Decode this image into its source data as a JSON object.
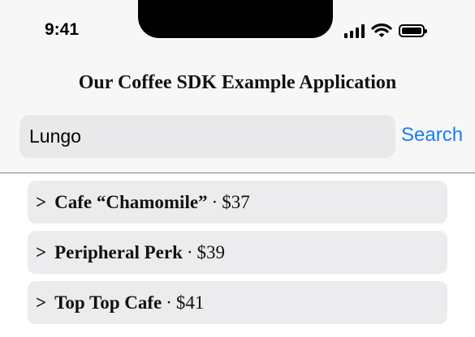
{
  "status_bar": {
    "time": "9:41",
    "icons": [
      "cellular-signal-icon",
      "wifi-icon",
      "battery-icon"
    ]
  },
  "header": {
    "title": "Our Coffee SDK Example Application"
  },
  "search": {
    "value": "Lungo",
    "button_label": "Search"
  },
  "results": [
    {
      "chevron": ">",
      "name": "Cafe “Chamomile”",
      "separator": "·",
      "price": "$37"
    },
    {
      "chevron": ">",
      "name": "Peripheral Perk",
      "separator": "·",
      "price": "$39"
    },
    {
      "chevron": ">",
      "name": "Top Top Cafe",
      "separator": "·",
      "price": "$41"
    }
  ],
  "colors": {
    "accent": "#1a7cf5",
    "header_background": "#f7f7f7",
    "field_background": "#e9e9eb",
    "row_background": "#ececee"
  }
}
